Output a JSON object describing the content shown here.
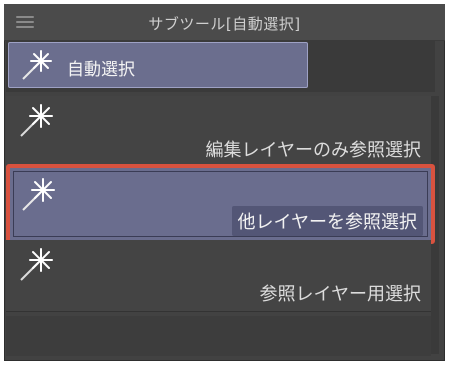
{
  "window": {
    "title": "サブツール[自動選択]"
  },
  "sub_tool_group": {
    "label": "自動選択",
    "icon": "magic-wand-icon"
  },
  "tools": [
    {
      "label": "編集レイヤーのみ参照選択",
      "icon": "magic-wand-icon",
      "selected": false
    },
    {
      "label": "他レイヤーを参照選択",
      "icon": "magic-wand-icon",
      "selected": true
    },
    {
      "label": "参照レイヤー用選択",
      "icon": "magic-wand-icon",
      "selected": false
    }
  ],
  "colors": {
    "panel_bg": "#424242",
    "selected_bg": "#6a6d8e",
    "highlight_border": "#d8523f"
  }
}
